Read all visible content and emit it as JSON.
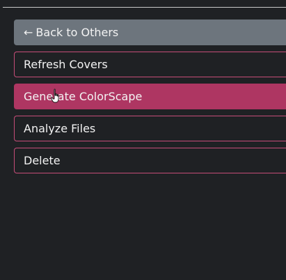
{
  "menu": {
    "back_arrow": "←",
    "back_label": "Back to Others",
    "items": [
      {
        "label": "Refresh Covers"
      },
      {
        "label": "Generate ColorScape"
      },
      {
        "label": "Analyze Files"
      },
      {
        "label": "Delete"
      }
    ]
  },
  "colors": {
    "background": "#1f2124",
    "back_button": "#6d757d",
    "outline_border": "#c74d79",
    "active_fill": "#ae3662",
    "text": "#f3f3f3"
  },
  "icons": {
    "cursor": "hand-pointer-icon"
  }
}
